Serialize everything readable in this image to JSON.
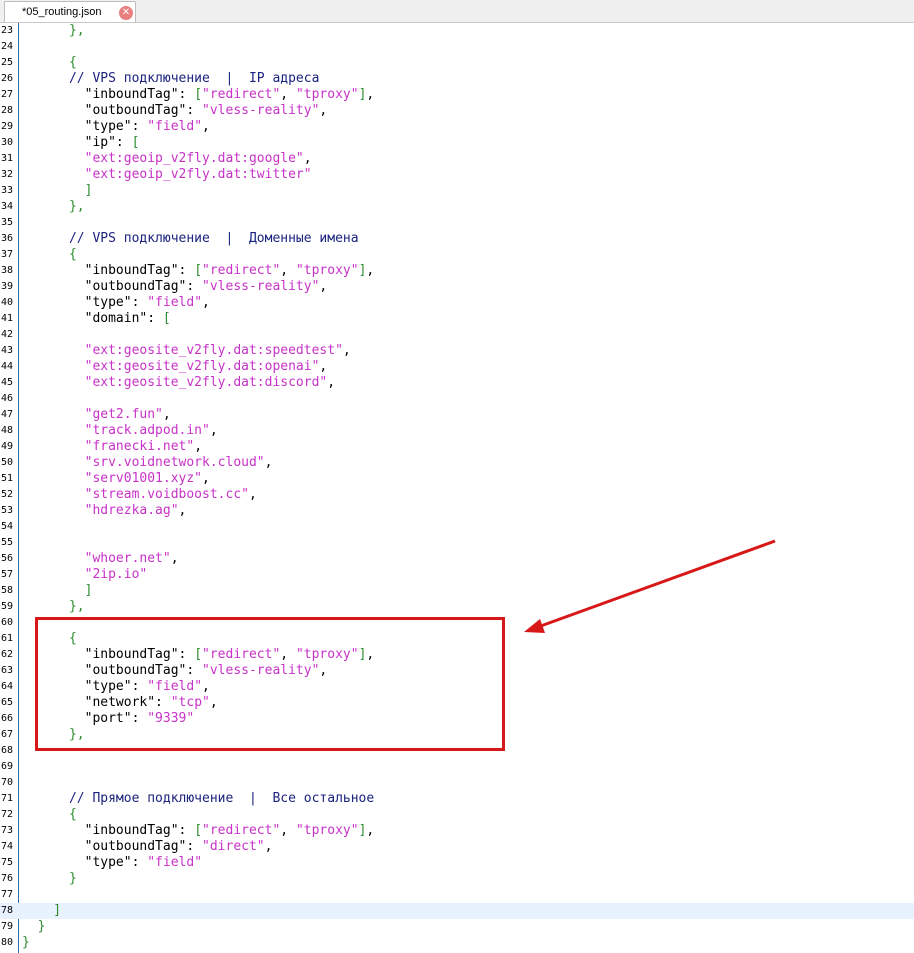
{
  "tab": {
    "title": "*05_routing.json",
    "close_icon": "close-icon"
  },
  "lines": [
    {
      "n": "23",
      "t": [
        [
          "p",
          "      },"
        ]
      ]
    },
    {
      "n": "24",
      "t": []
    },
    {
      "n": "25",
      "t": [
        [
          "p",
          "      {"
        ]
      ]
    },
    {
      "n": "26",
      "t": [
        [
          "c",
          "      // VPS подключение  |  IP адреса"
        ]
      ]
    },
    {
      "n": "27",
      "t": [
        [
          "k",
          "        \"inboundTag\": "
        ],
        [
          "p",
          "["
        ],
        [
          "s",
          "\"redirect\""
        ],
        [
          "k",
          ", "
        ],
        [
          "s",
          "\"tproxy\""
        ],
        [
          "p",
          "]"
        ],
        [
          "k",
          ","
        ]
      ]
    },
    {
      "n": "28",
      "t": [
        [
          "k",
          "        \"outboundTag\": "
        ],
        [
          "s",
          "\"vless-reality\""
        ],
        [
          "k",
          ","
        ]
      ]
    },
    {
      "n": "29",
      "t": [
        [
          "k",
          "        \"type\": "
        ],
        [
          "s",
          "\"field\""
        ],
        [
          "k",
          ","
        ]
      ]
    },
    {
      "n": "30",
      "t": [
        [
          "k",
          "        \"ip\": "
        ],
        [
          "p",
          "["
        ]
      ]
    },
    {
      "n": "31",
      "t": [
        [
          "s",
          "        \"ext:geoip_v2fly.dat:google\""
        ],
        [
          "k",
          ","
        ]
      ]
    },
    {
      "n": "32",
      "t": [
        [
          "s",
          "        \"ext:geoip_v2fly.dat:twitter\""
        ]
      ]
    },
    {
      "n": "33",
      "t": [
        [
          "p",
          "        ]"
        ]
      ]
    },
    {
      "n": "34",
      "t": [
        [
          "p",
          "      },"
        ]
      ]
    },
    {
      "n": "35",
      "t": []
    },
    {
      "n": "36",
      "t": [
        [
          "c",
          "      // VPS подключение  |  Доменные имена"
        ]
      ]
    },
    {
      "n": "37",
      "t": [
        [
          "p",
          "      {"
        ]
      ]
    },
    {
      "n": "38",
      "t": [
        [
          "k",
          "        \"inboundTag\": "
        ],
        [
          "p",
          "["
        ],
        [
          "s",
          "\"redirect\""
        ],
        [
          "k",
          ", "
        ],
        [
          "s",
          "\"tproxy\""
        ],
        [
          "p",
          "]"
        ],
        [
          "k",
          ","
        ]
      ]
    },
    {
      "n": "39",
      "t": [
        [
          "k",
          "        \"outboundTag\": "
        ],
        [
          "s",
          "\"vless-reality\""
        ],
        [
          "k",
          ","
        ]
      ]
    },
    {
      "n": "40",
      "t": [
        [
          "k",
          "        \"type\": "
        ],
        [
          "s",
          "\"field\""
        ],
        [
          "k",
          ","
        ]
      ]
    },
    {
      "n": "41",
      "t": [
        [
          "k",
          "        \"domain\": "
        ],
        [
          "p",
          "["
        ]
      ]
    },
    {
      "n": "42",
      "t": []
    },
    {
      "n": "43",
      "t": [
        [
          "s",
          "        \"ext:geosite_v2fly.dat:speedtest\""
        ],
        [
          "k",
          ","
        ]
      ]
    },
    {
      "n": "44",
      "t": [
        [
          "s",
          "        \"ext:geosite_v2fly.dat:openai\""
        ],
        [
          "k",
          ","
        ]
      ]
    },
    {
      "n": "45",
      "t": [
        [
          "s",
          "        \"ext:geosite_v2fly.dat:discord\""
        ],
        [
          "k",
          ","
        ]
      ]
    },
    {
      "n": "46",
      "t": []
    },
    {
      "n": "47",
      "t": [
        [
          "s",
          "        \"get2.fun\""
        ],
        [
          "k",
          ","
        ]
      ]
    },
    {
      "n": "48",
      "t": [
        [
          "s",
          "        \"track.adpod.in\""
        ],
        [
          "k",
          ","
        ]
      ]
    },
    {
      "n": "49",
      "t": [
        [
          "s",
          "        \"franecki.net\""
        ],
        [
          "k",
          ","
        ]
      ]
    },
    {
      "n": "50",
      "t": [
        [
          "s",
          "        \"srv.voidnetwork.cloud\""
        ],
        [
          "k",
          ","
        ]
      ]
    },
    {
      "n": "51",
      "t": [
        [
          "s",
          "        \"serv01001.xyz\""
        ],
        [
          "k",
          ","
        ]
      ]
    },
    {
      "n": "52",
      "t": [
        [
          "s",
          "        \"stream.voidboost.cc\""
        ],
        [
          "k",
          ","
        ]
      ]
    },
    {
      "n": "53",
      "t": [
        [
          "s",
          "        \"hdrezka.ag\""
        ],
        [
          "k",
          ","
        ]
      ]
    },
    {
      "n": "54",
      "t": []
    },
    {
      "n": "55",
      "t": []
    },
    {
      "n": "56",
      "t": [
        [
          "s",
          "        \"whoer.net\""
        ],
        [
          "k",
          ","
        ]
      ]
    },
    {
      "n": "57",
      "t": [
        [
          "s",
          "        \"2ip.io\""
        ]
      ]
    },
    {
      "n": "58",
      "t": [
        [
          "p",
          "        ]"
        ]
      ]
    },
    {
      "n": "59",
      "t": [
        [
          "p",
          "      },"
        ]
      ]
    },
    {
      "n": "60",
      "t": []
    },
    {
      "n": "61",
      "t": [
        [
          "p",
          "      {"
        ]
      ]
    },
    {
      "n": "62",
      "t": [
        [
          "k",
          "        \"inboundTag\": "
        ],
        [
          "p",
          "["
        ],
        [
          "s",
          "\"redirect\""
        ],
        [
          "k",
          ", "
        ],
        [
          "s",
          "\"tproxy\""
        ],
        [
          "p",
          "]"
        ],
        [
          "k",
          ","
        ]
      ]
    },
    {
      "n": "63",
      "t": [
        [
          "k",
          "        \"outboundTag\": "
        ],
        [
          "s",
          "\"vless-reality\""
        ],
        [
          "k",
          ","
        ]
      ]
    },
    {
      "n": "64",
      "t": [
        [
          "k",
          "        \"type\": "
        ],
        [
          "s",
          "\"field\""
        ],
        [
          "k",
          ","
        ]
      ]
    },
    {
      "n": "65",
      "t": [
        [
          "k",
          "        \"network\": "
        ],
        [
          "s",
          "\"tcp\""
        ],
        [
          "k",
          ","
        ]
      ]
    },
    {
      "n": "66",
      "t": [
        [
          "k",
          "        \"port\": "
        ],
        [
          "s",
          "\"9339\""
        ]
      ]
    },
    {
      "n": "67",
      "t": [
        [
          "p",
          "      },"
        ]
      ]
    },
    {
      "n": "68",
      "t": []
    },
    {
      "n": "69",
      "t": []
    },
    {
      "n": "70",
      "t": []
    },
    {
      "n": "71",
      "t": [
        [
          "c",
          "      // Прямое подключение  |  Все остальное"
        ]
      ]
    },
    {
      "n": "72",
      "t": [
        [
          "p",
          "      {"
        ]
      ]
    },
    {
      "n": "73",
      "t": [
        [
          "k",
          "        \"inboundTag\": "
        ],
        [
          "p",
          "["
        ],
        [
          "s",
          "\"redirect\""
        ],
        [
          "k",
          ", "
        ],
        [
          "s",
          "\"tproxy\""
        ],
        [
          "p",
          "]"
        ],
        [
          "k",
          ","
        ]
      ]
    },
    {
      "n": "74",
      "t": [
        [
          "k",
          "        \"outboundTag\": "
        ],
        [
          "s",
          "\"direct\""
        ],
        [
          "k",
          ","
        ]
      ]
    },
    {
      "n": "75",
      "t": [
        [
          "k",
          "        \"type\": "
        ],
        [
          "s",
          "\"field\""
        ]
      ]
    },
    {
      "n": "76",
      "t": [
        [
          "p",
          "      }"
        ]
      ]
    },
    {
      "n": "77",
      "t": []
    },
    {
      "n": "78",
      "t": [
        [
          "p",
          "    ]"
        ]
      ],
      "current": true
    },
    {
      "n": "79",
      "t": [
        [
          "p",
          "  }"
        ]
      ]
    },
    {
      "n": "80",
      "t": [
        [
          "p",
          "}"
        ]
      ]
    }
  ]
}
